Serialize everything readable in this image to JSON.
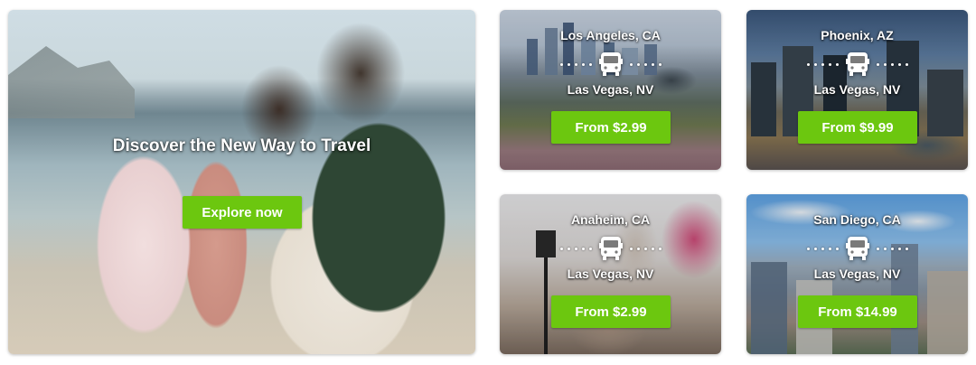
{
  "hero": {
    "title": "Discover the New Way to Travel",
    "button_label": "Explore now"
  },
  "routes": [
    {
      "from": "Los Angeles, CA",
      "to": "Las Vegas, NV",
      "price_label": "From $2.99"
    },
    {
      "from": "Phoenix, AZ",
      "to": "Las Vegas, NV",
      "price_label": "From $9.99"
    },
    {
      "from": "Anaheim, CA",
      "to": "Las Vegas, NV",
      "price_label": "From $2.99"
    },
    {
      "from": "San Diego, CA",
      "to": "Las Vegas, NV",
      "price_label": "From $14.99"
    }
  ],
  "colors": {
    "accent": "#6cc70f",
    "text_on_image": "#ffffff"
  },
  "icons": {
    "route_icon": "bus-icon"
  }
}
